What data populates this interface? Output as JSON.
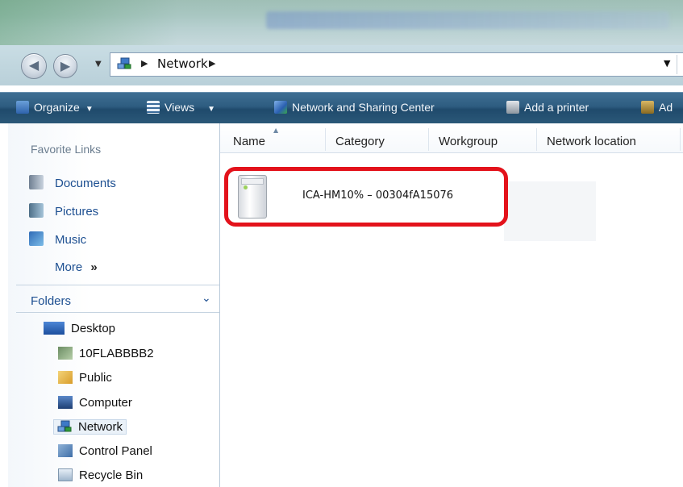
{
  "address": {
    "crumbs": [
      "Network"
    ],
    "icon": "network-icon"
  },
  "toolbar": {
    "organize": "Organize",
    "views": "Views",
    "network_center": "Network and Sharing Center",
    "add_printer": "Add a printer",
    "add_truncated": "Ad"
  },
  "nav": {
    "favorite_links_heading": "Favorite Links",
    "links": [
      {
        "label": "Documents",
        "icon": "documents-icon"
      },
      {
        "label": "Pictures",
        "icon": "pictures-icon"
      },
      {
        "label": "Music",
        "icon": "music-icon"
      }
    ],
    "more": "More",
    "more_glyph": "»",
    "folders_heading": "Folders",
    "tree": [
      {
        "label": "Desktop",
        "icon": "desktop-icon"
      },
      {
        "label": "10FLABBBB2",
        "icon": "user-folder-icon"
      },
      {
        "label": "Public",
        "icon": "folder-icon"
      },
      {
        "label": "Computer",
        "icon": "computer-icon"
      },
      {
        "label": "Network",
        "icon": "network-icon",
        "selected": true
      },
      {
        "label": "Control Panel",
        "icon": "control-panel-icon"
      },
      {
        "label": "Recycle Bin",
        "icon": "recycle-bin-icon"
      }
    ]
  },
  "columns": [
    "Name",
    "Category",
    "Workgroup",
    "Network location"
  ],
  "device": {
    "label": "ICA-HM10% – 00304fA15076",
    "icon": "network-storage-icon"
  },
  "colors": {
    "highlight": "#e3121b",
    "toolbar": "#2d5c80",
    "link": "#1d4f91"
  }
}
